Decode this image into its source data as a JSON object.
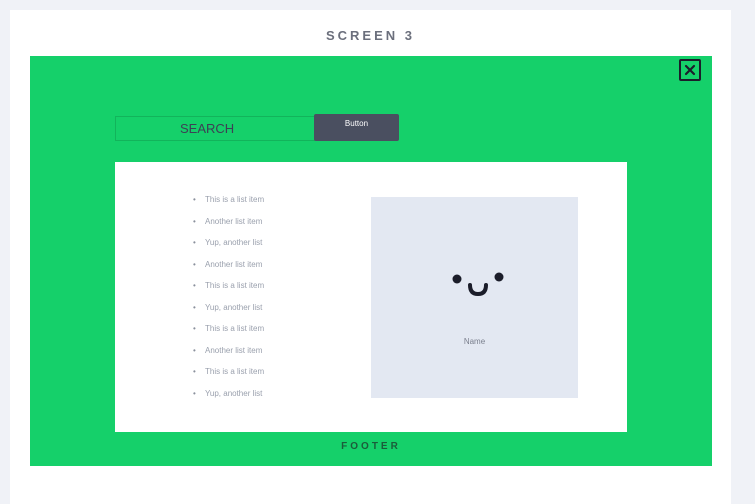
{
  "screen": {
    "title": "SCREEN 3"
  },
  "modal": {
    "close_icon": "close-icon",
    "search": {
      "placeholder": "SEARCH"
    },
    "button_label": "Button",
    "list_items": [
      "This is a list item",
      "Another list item",
      "Yup, another list",
      "Another list item",
      "This is a list item",
      "Yup, another list",
      "This is a list item",
      "Another list item",
      "This is a list item",
      "Yup, another list"
    ],
    "profile": {
      "icon": "smiley-face-icon",
      "name": "Name"
    },
    "footer": "FOOTER"
  },
  "colors": {
    "modal_background": "#15d06a",
    "button_background": "#4a4f60",
    "profile_background": "#e3e8f2"
  }
}
